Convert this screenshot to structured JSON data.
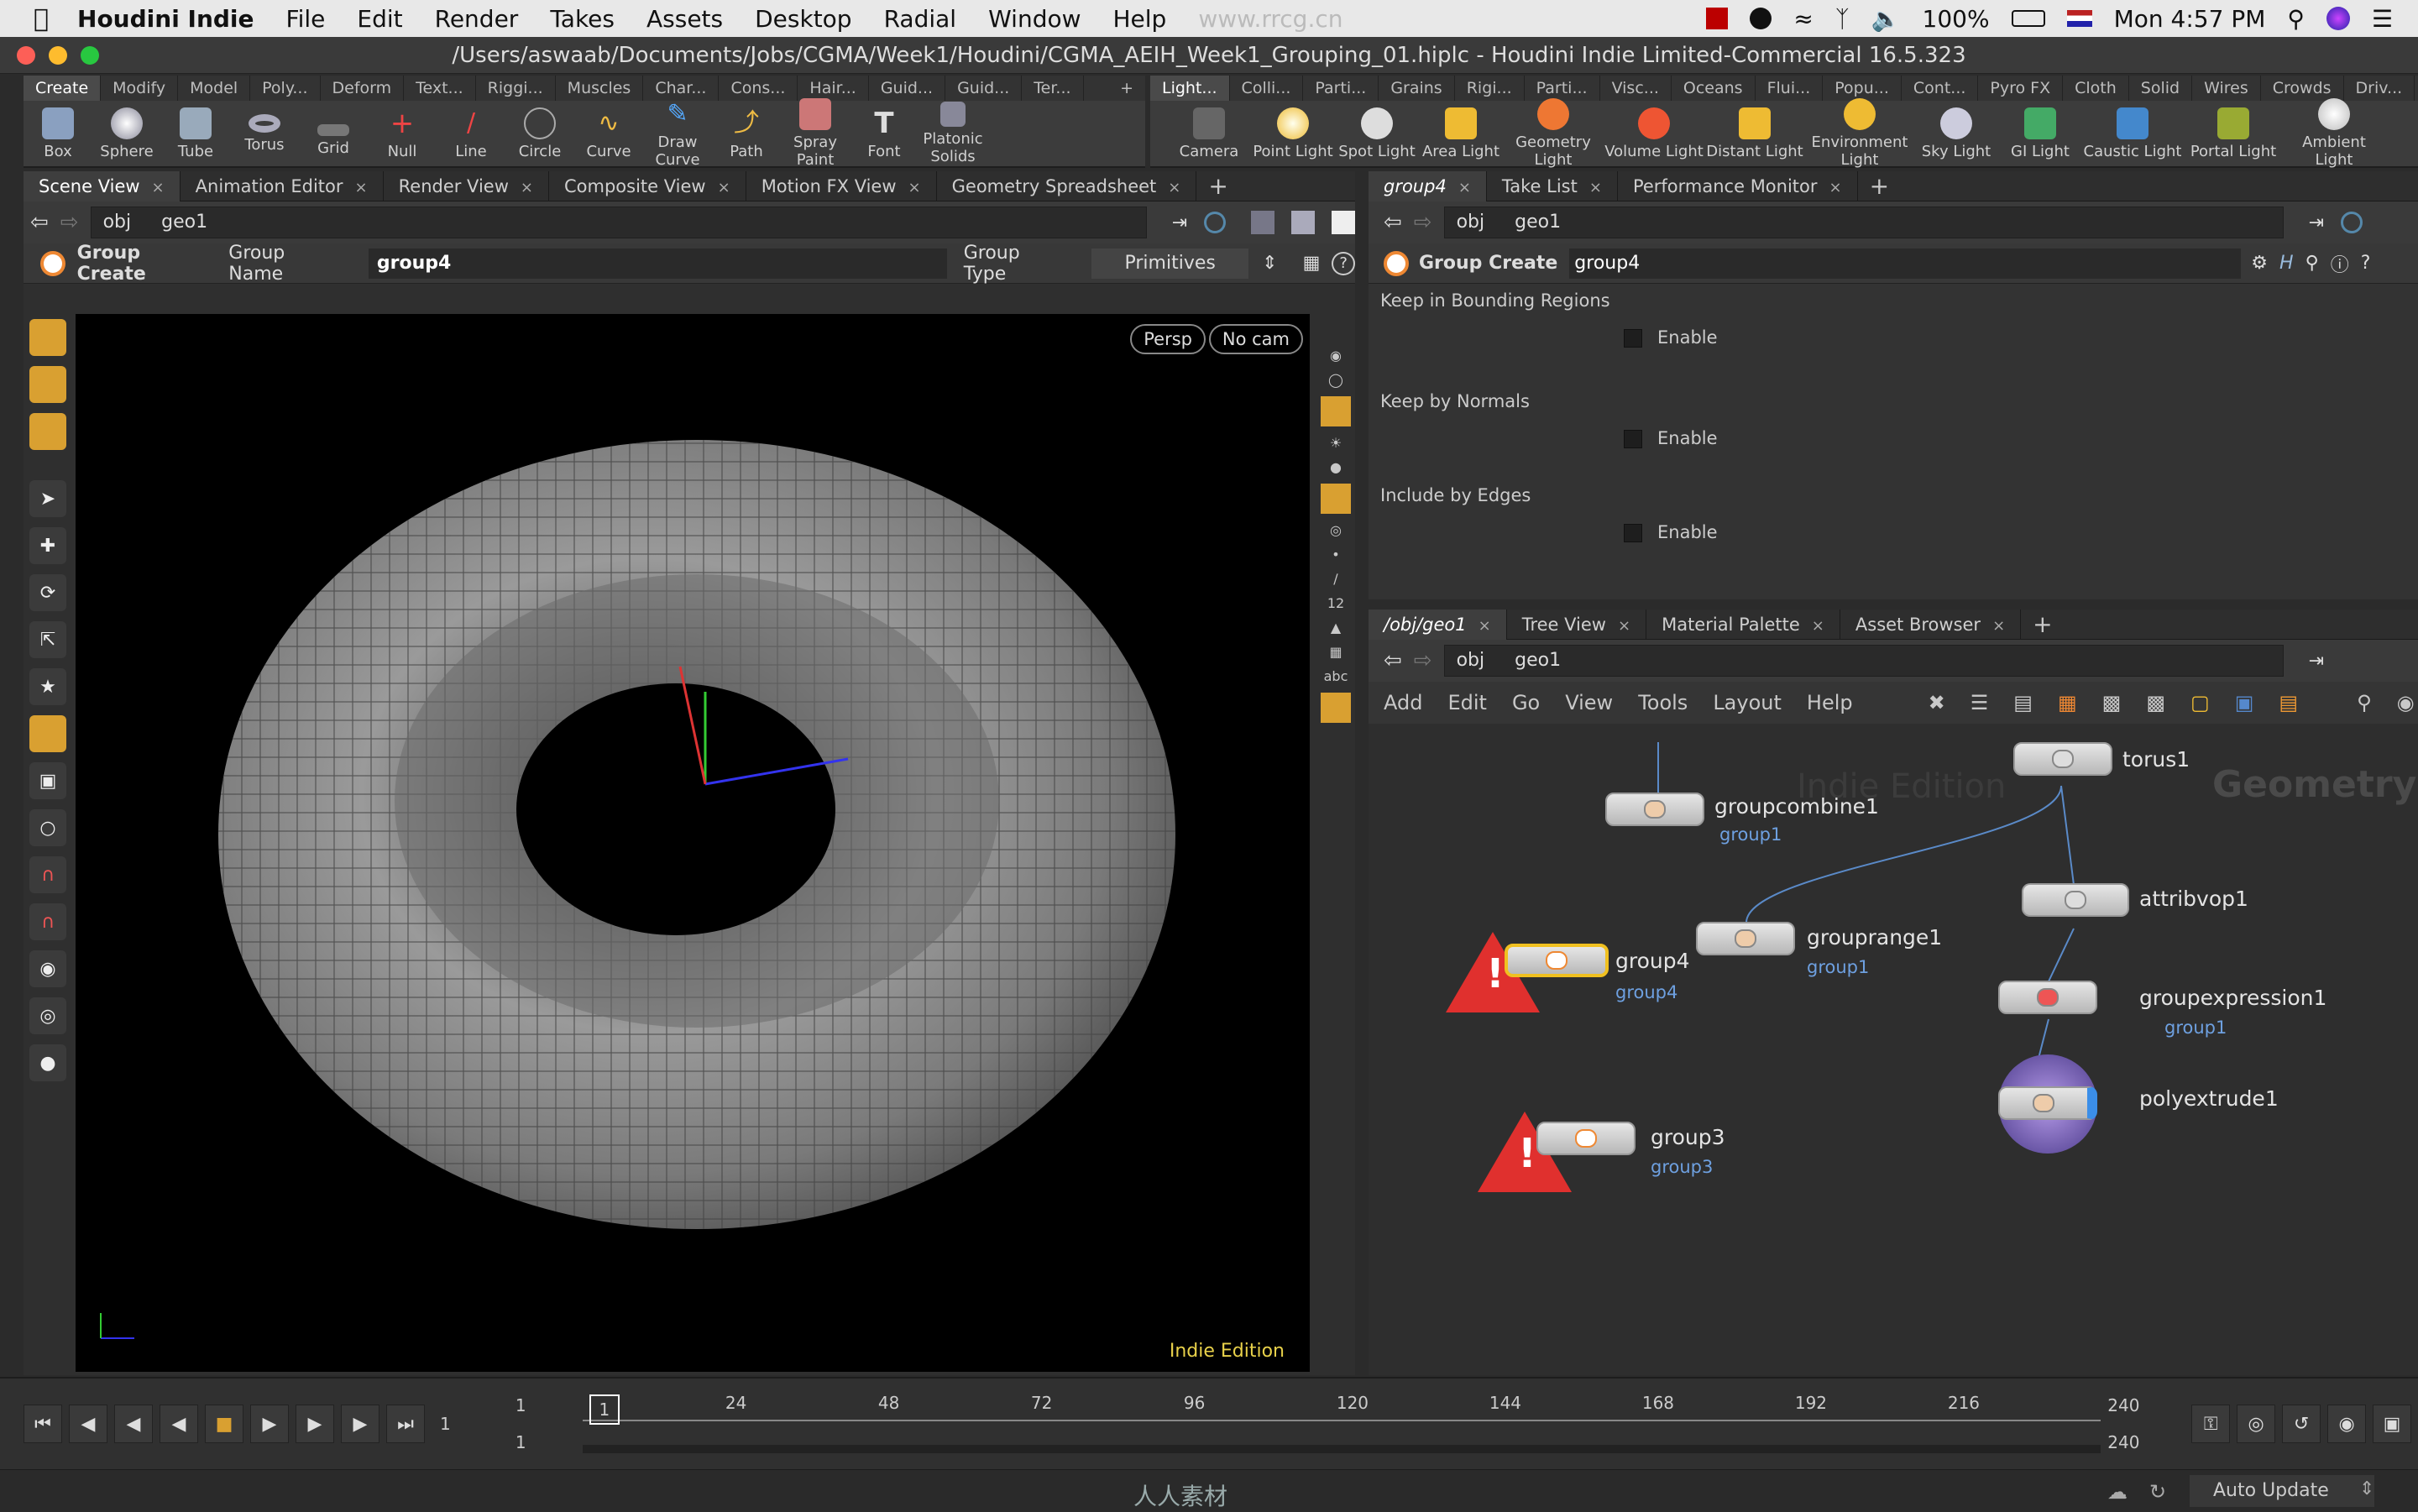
{
  "menubar": {
    "apple": "",
    "app": "Houdini Indie",
    "items": [
      "File",
      "Edit",
      "Render",
      "Takes",
      "Assets",
      "Desktop",
      "Radial",
      "Window",
      "Help"
    ],
    "watermark": "www.rrcg.cn",
    "battery": "100%",
    "clock": "Mon 4:57 PM"
  },
  "window": {
    "title": "/Users/aswaab/Documents/Jobs/CGMA/Week1/Houdini/CGMA_AEIH_Week1_Grouping_01.hiplc - Houdini Indie Limited-Commercial 16.5.323"
  },
  "shelf_left": {
    "tabs": [
      "Create",
      "Modify",
      "Model",
      "Poly...",
      "Deform",
      "Text...",
      "Riggi...",
      "Muscles",
      "Char...",
      "Cons...",
      "Hair...",
      "Guid...",
      "Guid...",
      "Ter..."
    ],
    "tools": [
      "Box",
      "Sphere",
      "Tube",
      "Torus",
      "Grid",
      "Null",
      "Line",
      "Circle",
      "Curve",
      "Draw Curve",
      "Path",
      "Spray Paint",
      "Font",
      "Platonic Solids"
    ]
  },
  "shelf_right": {
    "tabs": [
      "Light...",
      "Colli...",
      "Parti...",
      "Grains",
      "Rigi...",
      "Parti...",
      "Visc...",
      "Oceans",
      "Flui...",
      "Popu...",
      "Cont...",
      "Pyro FX",
      "Cloth",
      "Solid",
      "Wires",
      "Crowds",
      "Driv..."
    ],
    "tools": [
      "Camera",
      "Point Light",
      "Spot Light",
      "Area Light",
      "Geometry Light",
      "Volume Light",
      "Distant Light",
      "Environment Light",
      "Sky Light",
      "GI Light",
      "Caustic Light",
      "Portal Light",
      "Ambient Light"
    ]
  },
  "left_pane": {
    "tabs": [
      "Scene View",
      "Animation Editor",
      "Render View",
      "Composite View",
      "Motion FX View",
      "Geometry Spreadsheet"
    ],
    "path": [
      "obj",
      "geo1"
    ],
    "op": {
      "title": "Group Create",
      "name_label": "Group Name",
      "name_value": "group4",
      "type_label": "Group Type",
      "type_value": "Primitives"
    },
    "view": {
      "persp": "Persp",
      "cam": "No cam",
      "edition": "Indie Edition"
    }
  },
  "right_top": {
    "tabs": [
      "group4",
      "Take List",
      "Performance Monitor"
    ],
    "path": [
      "obj",
      "geo1"
    ],
    "op": {
      "title": "Group Create",
      "name": "group4"
    },
    "sections": [
      {
        "label": "Keep in Bounding Regions",
        "check": "Enable"
      },
      {
        "label": "Keep by Normals",
        "check": "Enable"
      },
      {
        "label": "Include by Edges",
        "check": "Enable"
      }
    ]
  },
  "right_bottom": {
    "tabs": [
      "/obj/geo1",
      "Tree View",
      "Material Palette",
      "Asset Browser"
    ],
    "path": [
      "obj",
      "geo1"
    ],
    "menu": [
      "Add",
      "Edit",
      "Go",
      "View",
      "Tools",
      "Layout",
      "Help"
    ],
    "network": {
      "edition": "Indie Edition",
      "context": "Geometry",
      "nodes": [
        {
          "name": "torus1",
          "group": ""
        },
        {
          "name": "groupcombine1",
          "group": "group1"
        },
        {
          "name": "attribvop1",
          "group": ""
        },
        {
          "name": "group4",
          "group": "group4"
        },
        {
          "name": "grouprange1",
          "group": "group1"
        },
        {
          "name": "groupexpression1",
          "group": "group1"
        },
        {
          "name": "polyextrude1",
          "group": ""
        },
        {
          "name": "group3",
          "group": "group3"
        }
      ]
    }
  },
  "timeline": {
    "frame": "1",
    "start": "1",
    "start2": "1",
    "end": "240",
    "end2": "240",
    "ticks": [
      "1",
      "24",
      "48",
      "72",
      "96",
      "120",
      "144",
      "168",
      "192",
      "216"
    ],
    "auto_update": "Auto Update",
    "footer_wm": "人人素材"
  }
}
